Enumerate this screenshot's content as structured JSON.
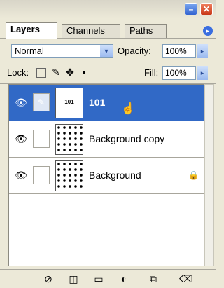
{
  "window": {
    "minimize_glyph": "–",
    "close_glyph": "✕"
  },
  "tabs": [
    {
      "label": "Layers",
      "active": true
    },
    {
      "label": "Channels",
      "active": false
    },
    {
      "label": "Paths",
      "active": false
    }
  ],
  "menu_arrow_glyph": "▸",
  "blend_mode": {
    "value": "Normal",
    "arrow": "▼"
  },
  "opacity": {
    "label": "Opacity:",
    "value": "100%",
    "arrow": "▸"
  },
  "lock": {
    "label": "Lock:",
    "icons": [
      "lock-transparent-icon",
      "lock-paint-icon",
      "lock-position-icon",
      "lock-all-icon"
    ]
  },
  "fill": {
    "label": "Fill:",
    "value": "100%",
    "arrow": "▸"
  },
  "layers": [
    {
      "name": "101",
      "selected": true,
      "thumb": "text",
      "thumb_text": "101",
      "locked": false
    },
    {
      "name": "Background copy",
      "selected": false,
      "thumb": "dots",
      "locked": false
    },
    {
      "name": "Background",
      "selected": false,
      "thumb": "dots",
      "locked": true
    }
  ],
  "glyphs": {
    "eye": "👁",
    "brush": "✎",
    "lock": "🔒",
    "hand": "☝"
  },
  "colors": {
    "selection": "#3169c6",
    "panel": "#ece9d8"
  },
  "bottom_icons": [
    "link-icon",
    "layer-style-icon",
    "mask-icon",
    "adjustment-icon",
    "new-layer-icon",
    "trash-icon"
  ]
}
